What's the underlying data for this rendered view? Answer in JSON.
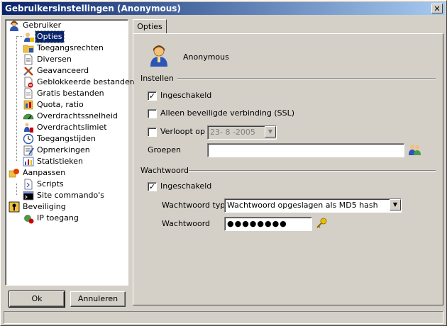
{
  "window": {
    "title": "Gebruikersinstellingen (Anonymous)",
    "close_glyph": "✕"
  },
  "tree": {
    "items": [
      {
        "label": "Gebruiker",
        "icon": "user-icon"
      },
      {
        "label": "Opties",
        "icon": "user-options-icon",
        "selected": true
      },
      {
        "label": "Toegangsrechten",
        "icon": "folder-rights-icon"
      },
      {
        "label": "Diversen",
        "icon": "document-icon"
      },
      {
        "label": "Geavanceerd",
        "icon": "tools-icon"
      },
      {
        "label": "Geblokkeerde bestanden",
        "icon": "blocked-file-icon"
      },
      {
        "label": "Gratis bestanden",
        "icon": "free-file-icon"
      },
      {
        "label": "Quota, ratio",
        "icon": "quota-icon"
      },
      {
        "label": "Overdrachtssnelheid",
        "icon": "speed-gauge-icon"
      },
      {
        "label": "Overdrachtslimiet",
        "icon": "transfer-limit-icon"
      },
      {
        "label": "Toegangstijden",
        "icon": "clock-icon"
      },
      {
        "label": "Opmerkingen",
        "icon": "notes-icon"
      },
      {
        "label": "Statistieken",
        "icon": "statistics-icon"
      },
      {
        "label": "Aanpassen",
        "icon": "customize-icon"
      },
      {
        "label": "Scripts",
        "icon": "script-icon"
      },
      {
        "label": "Site commando's",
        "icon": "command-prompt-icon"
      },
      {
        "label": "Beveiliging",
        "icon": "security-icon"
      },
      {
        "label": "IP toegang",
        "icon": "ip-access-icon"
      }
    ]
  },
  "buttons": {
    "ok": "Ok",
    "cancel": "Annuleren"
  },
  "tab": {
    "label": "Opties"
  },
  "user": {
    "name": "Anonymous"
  },
  "instellen": {
    "heading": "Instellen",
    "enabled_label": "Ingeschakeld",
    "enabled_checked": true,
    "ssl_label": "Alleen beveiligde verbinding (SSL)",
    "ssl_checked": false,
    "expires_label": "Verloopt op",
    "expires_checked": false,
    "expires_date": "23- 8 -2005",
    "groups_label": "Groepen",
    "groups_value": ""
  },
  "wachtwoord": {
    "heading": "Wachtwoord",
    "enabled_label": "Ingeschakeld",
    "enabled_checked": true,
    "type_label": "Wachtwoord type",
    "type_value": "Wachtwoord opgeslagen als MD5 hash",
    "password_label": "Wachtwoord",
    "password_value": "●●●●●●●●"
  },
  "glyphs": {
    "check": "✓",
    "dropdown": "▼"
  }
}
